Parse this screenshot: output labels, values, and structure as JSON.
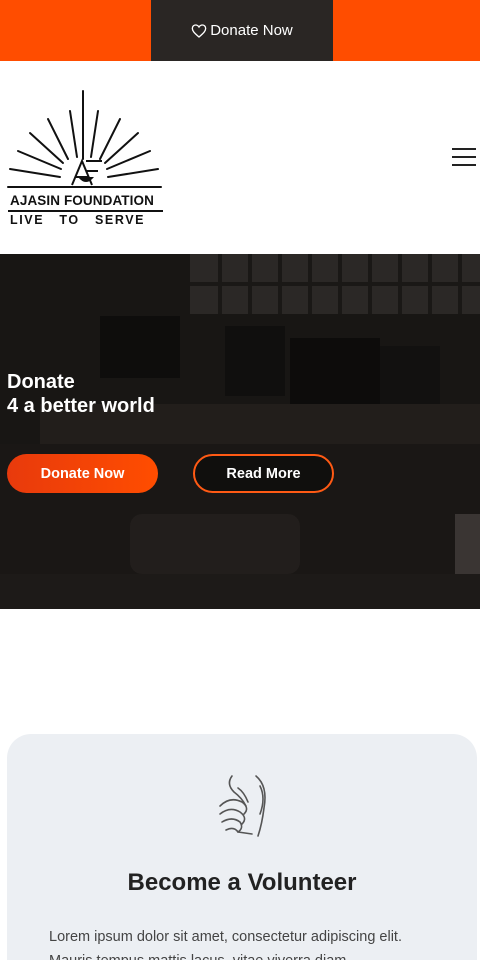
{
  "topbar": {
    "donate_label": "Donate Now",
    "accent_color": "#ff4d00"
  },
  "header": {
    "logo": {
      "monogram": "AF",
      "name": "AJASIN FOUNDATION",
      "tagline": "LIVE   TO   SERVE"
    },
    "menu_icon": "hamburger-menu-icon"
  },
  "hero": {
    "title_line1": "Donate",
    "title_line2": "4 a better world",
    "primary_button": "Donate Now",
    "secondary_button": "Read More"
  },
  "volunteer_card": {
    "icon": "helping-hands-icon",
    "title": "Become a Volunteer",
    "text": "Lorem ipsum dolor sit amet, consectetur adipiscing elit. Mauris tempus mattis lacus, vitae viverra diam."
  }
}
